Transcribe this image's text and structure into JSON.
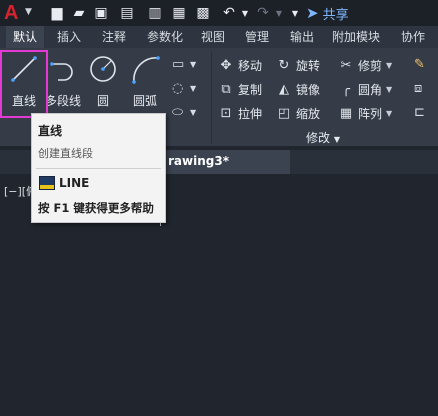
{
  "app": {
    "logo_letter": "A",
    "share_label": "共享"
  },
  "qat_icons": [
    "new-file-icon",
    "open-folder-icon",
    "save-icon",
    "save-as-icon",
    "open-from-web-icon",
    "save-to-web-icon",
    "plot-icon",
    "undo-icon",
    "redo-icon",
    "customize-dropdown-icon"
  ],
  "ribbon_tabs": [
    "默认",
    "插入",
    "注释",
    "参数化",
    "视图",
    "管理",
    "输出",
    "附加模块",
    "协作"
  ],
  "active_tab": "默认",
  "draw_tools": {
    "line": "直线",
    "polyline": "多段线",
    "circle": "圆",
    "arc": "圆弧"
  },
  "modify": {
    "move": "移动",
    "rotate": "旋转",
    "trim": "修剪",
    "copy": "复制",
    "mirror": "镜像",
    "fillet": "圆角",
    "stretch": "拉伸",
    "scale": "缩放",
    "array": "阵列",
    "panel_label": "修改"
  },
  "document": {
    "tab_title": "rawing3*",
    "viewport_label": "[−][俯"
  },
  "tooltip": {
    "title": "直线",
    "description": "创建直线段",
    "command": "LINE",
    "help": "按 F1 键获得更多帮助"
  },
  "colors": {
    "accent_highlight": "#e33ad6",
    "logo_red": "#d3232f",
    "share_blue": "#7fb6ff"
  }
}
